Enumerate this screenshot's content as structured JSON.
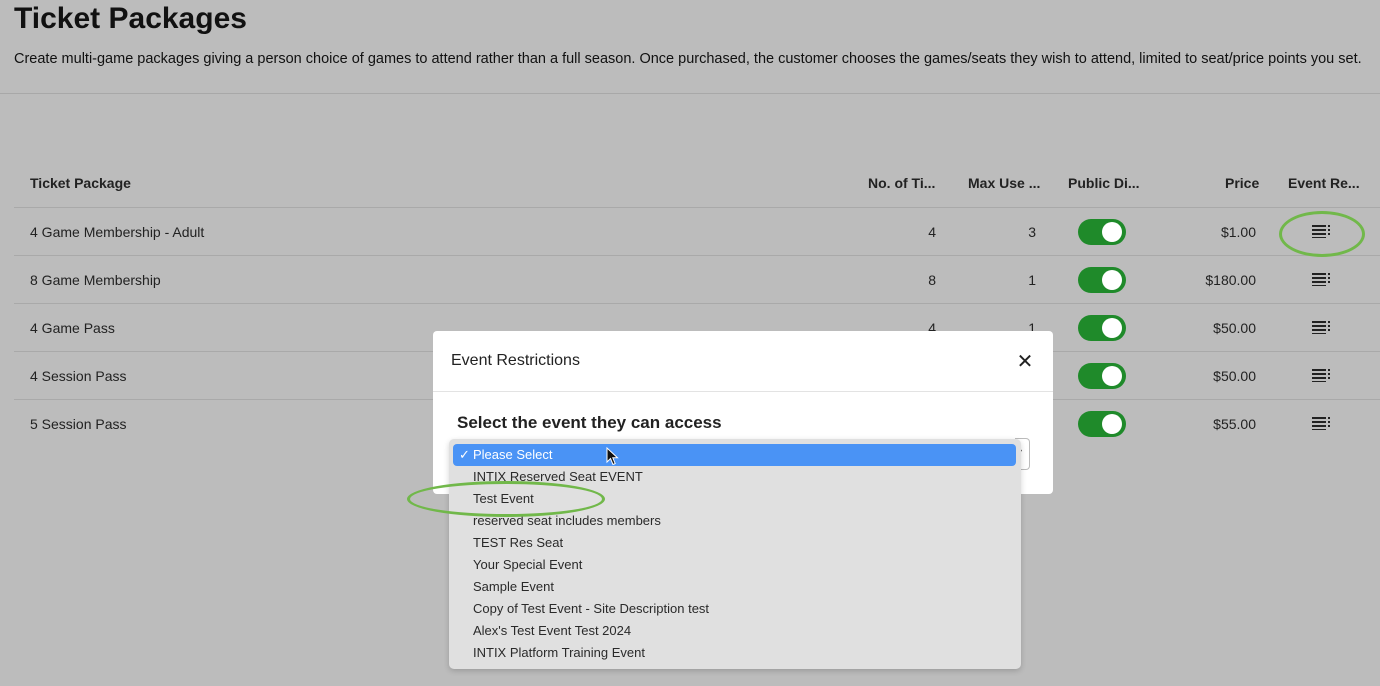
{
  "header": {
    "title": "Ticket Packages",
    "description": "Create multi-game packages giving a person choice of games to attend rather than a full season. Once purchased, the customer chooses the games/seats they wish to attend, limited to seat/price points you set."
  },
  "table": {
    "columns": [
      "Ticket Package",
      "No. of Ti...",
      "Max Use ...",
      "Public Di...",
      "Price",
      "Event Re..."
    ],
    "rows": [
      {
        "name": "4 Game Membership - Adult",
        "tickets": "4",
        "max_use": "3",
        "public": true,
        "price": "$1.00"
      },
      {
        "name": "8 Game Membership",
        "tickets": "8",
        "max_use": "1",
        "public": true,
        "price": "$180.00"
      },
      {
        "name": "4 Game Pass",
        "tickets": "4",
        "max_use": "1",
        "public": true,
        "price": "$50.00"
      },
      {
        "name": "4 Session Pass",
        "tickets": "",
        "max_use": "",
        "public": true,
        "price": "$50.00"
      },
      {
        "name": "5 Session Pass",
        "tickets": "",
        "max_use": "",
        "public": true,
        "price": "$55.00"
      }
    ]
  },
  "modal": {
    "title": "Event Restrictions",
    "close_icon": "close-icon",
    "label": "Select the event they can access",
    "select": {
      "selected": "Please Select",
      "check_glyph": "✓",
      "options": [
        "Please Select",
        "INTIX Reserved Seat EVENT",
        "Test Event",
        "reserved seat includes members",
        "TEST Res Seat",
        "Your Special Event",
        "Sample Event",
        "Copy of Test Event - Site Description test",
        "Alex's Test Event Test 2024",
        "INTIX Platform Training Event"
      ]
    }
  },
  "colors": {
    "toggle_on": "#1f8a2a",
    "highlight_ring": "#71b84a",
    "selected_option": "#4a93f5",
    "overlay": "#bcbcbc"
  }
}
